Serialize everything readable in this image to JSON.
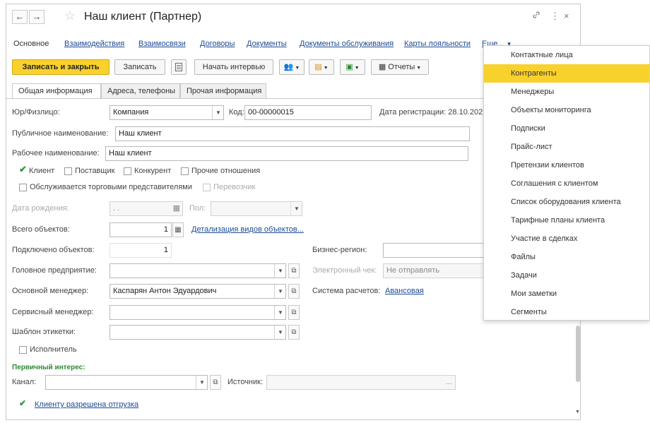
{
  "window": {
    "title": "Наш клиент (Партнер)"
  },
  "titlebar": {
    "back": "←",
    "forward": "→",
    "star": "☆",
    "link": "🔗",
    "more": "⋮",
    "close": "×"
  },
  "nav_tabs": [
    "Основное",
    "Взаимодействия",
    "Взаимосвязи",
    "Договоры",
    "Документы",
    "Документы обслуживания",
    "Карты лояльности",
    "Еще..."
  ],
  "toolbar": {
    "save_close": "Записать и закрыть",
    "save": "Записать",
    "interview": "Начать интервью",
    "reports": "Отчеты"
  },
  "form_tabs": [
    "Общая информация",
    "Адреса, телефоны",
    "Прочая информация"
  ],
  "form": {
    "legal_label": "Юр/Физлицо:",
    "legal_value": "Компания",
    "code_label": "Код:",
    "code_value": "00-00000015",
    "reg_label": "Дата регистрации: 28.10.202",
    "public_name_label": "Публичное наименование:",
    "public_name_value": "Наш клиент",
    "work_name_label": "Рабочее наименование:",
    "work_name_value": "Наш клиент",
    "chk_client": "Клиент",
    "chk_supplier": "Поставщик",
    "chk_competitor": "Конкурент",
    "chk_other": "Прочие отношения",
    "chk_trade_reps": "Обслуживается торговыми представителями",
    "chk_carrier": "Перевозчик",
    "birth_label": "Дата рождения:",
    "birth_value": ". .",
    "gender_label": "Пол:",
    "objects_total_label": "Всего объектов:",
    "objects_total_value": "1",
    "objects_detail_link": "Детализация видов объектов...",
    "objects_connected_label": "Подключено объектов:",
    "objects_connected_value": "1",
    "biz_region_label": "Бизнес-регион:",
    "head_company_label": "Головное предприятие:",
    "e_receipt_label": "Электронный чек:",
    "e_receipt_value": "Не отправлять",
    "main_manager_label": "Основной менеджер:",
    "main_manager_value": "Каспарян Антон Эдуардович",
    "pay_system_label": "Система расчетов:",
    "pay_system_link": "Авансовая",
    "service_manager_label": "Сервисный менеджер:",
    "label_template_label": "Шаблон этикетки:",
    "chk_executor": "Исполнитель",
    "primary_interest": "Первичный интерес:",
    "channel_label": "Канал:",
    "source_label": "Источник:",
    "source_btn": "...",
    "shipment_link": "Клиенту разрешена отгрузка"
  },
  "menu": {
    "items": [
      "Контактные лица",
      "Контрагенты",
      "Менеджеры",
      "Объекты мониторинга",
      "Подписки",
      "Прайс-лист",
      "Претензии клиентов",
      "Соглашения с клиентом",
      "Список оборудования клиента",
      "Тарифные планы клиента",
      "Участие в сделках",
      "Файлы",
      "Задачи",
      "Мои заметки",
      "Сегменты"
    ],
    "highlighted_index": 1
  },
  "colors": {
    "accent": "#f9d12c",
    "link": "#1d4a94",
    "green": "#2c8a30"
  }
}
